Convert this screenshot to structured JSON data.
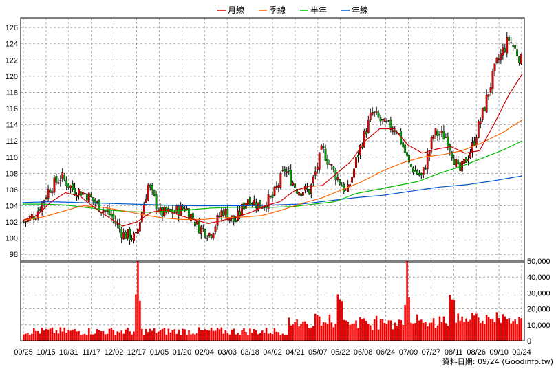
{
  "legend": [
    {
      "label": "月線",
      "color": "#cc0000"
    },
    {
      "label": "季線",
      "color": "#ff6600"
    },
    {
      "label": "半年",
      "color": "#00bb00"
    },
    {
      "label": "年線",
      "color": "#0055cc"
    }
  ],
  "footer": {
    "text": "資料日期: 09/24  (Goodinfo.tw)"
  },
  "chart_data": {
    "type": "candlestick+volume",
    "price_axis": {
      "ticks": [
        98,
        100,
        102,
        104,
        106,
        108,
        110,
        112,
        114,
        116,
        118,
        120,
        122,
        124,
        126
      ],
      "ylim": [
        97,
        127.2
      ]
    },
    "volume_axis": {
      "ticks": [
        0,
        10000,
        20000,
        30000,
        40000,
        50000
      ],
      "tick_labels": [
        "0",
        "10,000",
        "20,000",
        "30,000",
        "40,000",
        "50,000"
      ],
      "ylim": [
        0,
        50000
      ]
    },
    "x_labels": [
      "09/25",
      "10/15",
      "10/31",
      "11/17",
      "12/02",
      "12/17",
      "01/05",
      "01/20",
      "02/04",
      "03/03",
      "03/18",
      "04/02",
      "04/21",
      "05/07",
      "05/22",
      "06/08",
      "06/24",
      "07/09",
      "07/27",
      "08/11",
      "08/26",
      "09/10",
      "09/24"
    ],
    "close_anchors": [
      102,
      103,
      106,
      107.6,
      106,
      105.5,
      104,
      102.8,
      100.5,
      100,
      106.5,
      103,
      103.2,
      103.8,
      101.5,
      100.5,
      103.5,
      102,
      105,
      104,
      105,
      108.5,
      106,
      105.8,
      111,
      108,
      105.5,
      111,
      115.5,
      114,
      113.5,
      109,
      107.5,
      113,
      112.5,
      108,
      111,
      116,
      121.5,
      124.6,
      122
    ],
    "month_ma": [
      102.2,
      102.8,
      104.5,
      105.6,
      105.2,
      103.8,
      102.6,
      101.5,
      102,
      103.2,
      103.5,
      102.8,
      102.3,
      101.8,
      102.2,
      102.6,
      103.2,
      104,
      104.5,
      105.8,
      106.4,
      106.5,
      108,
      109.5,
      112,
      113.5,
      113.5,
      111.5,
      110.5,
      111,
      111.3,
      110.5,
      110.8,
      114,
      117.5,
      120.3
    ],
    "quarter_ma": [
      102.2,
      102.6,
      103.3,
      104,
      103.8,
      103.4,
      102.9,
      102.5,
      102.3,
      102.3,
      102.5,
      102.6,
      102.8,
      103.5,
      104.3,
      105,
      106,
      107,
      108.3,
      109.3,
      110,
      110.3,
      110.8,
      111.8,
      113,
      114.6
    ],
    "half_ma": [
      104.2,
      104.2,
      104.1,
      103.8,
      103.5,
      103.3,
      103.2,
      103.3,
      103.5,
      103.7,
      103.8,
      103.8,
      103.8,
      103.9,
      104.2,
      104.5,
      105.5,
      106,
      106.5,
      107,
      108,
      108.8,
      109.8,
      110.8,
      112
    ],
    "year_ma": [
      104.4,
      104.5,
      104.4,
      104.3,
      104.2,
      104.1,
      104,
      104,
      104,
      104.1,
      104.2,
      104.6,
      105,
      105.3,
      105.8,
      106.3,
      106.6,
      107.1,
      107.7
    ],
    "volume_peaks": [
      {
        "label": "12/17",
        "value": 50000
      },
      {
        "label": "07/09",
        "value": 50000
      },
      {
        "label": "05/22",
        "value": 26000
      },
      {
        "label": "08/11",
        "value": 26000
      }
    ],
    "grid": true,
    "legend_position": "top-center"
  }
}
